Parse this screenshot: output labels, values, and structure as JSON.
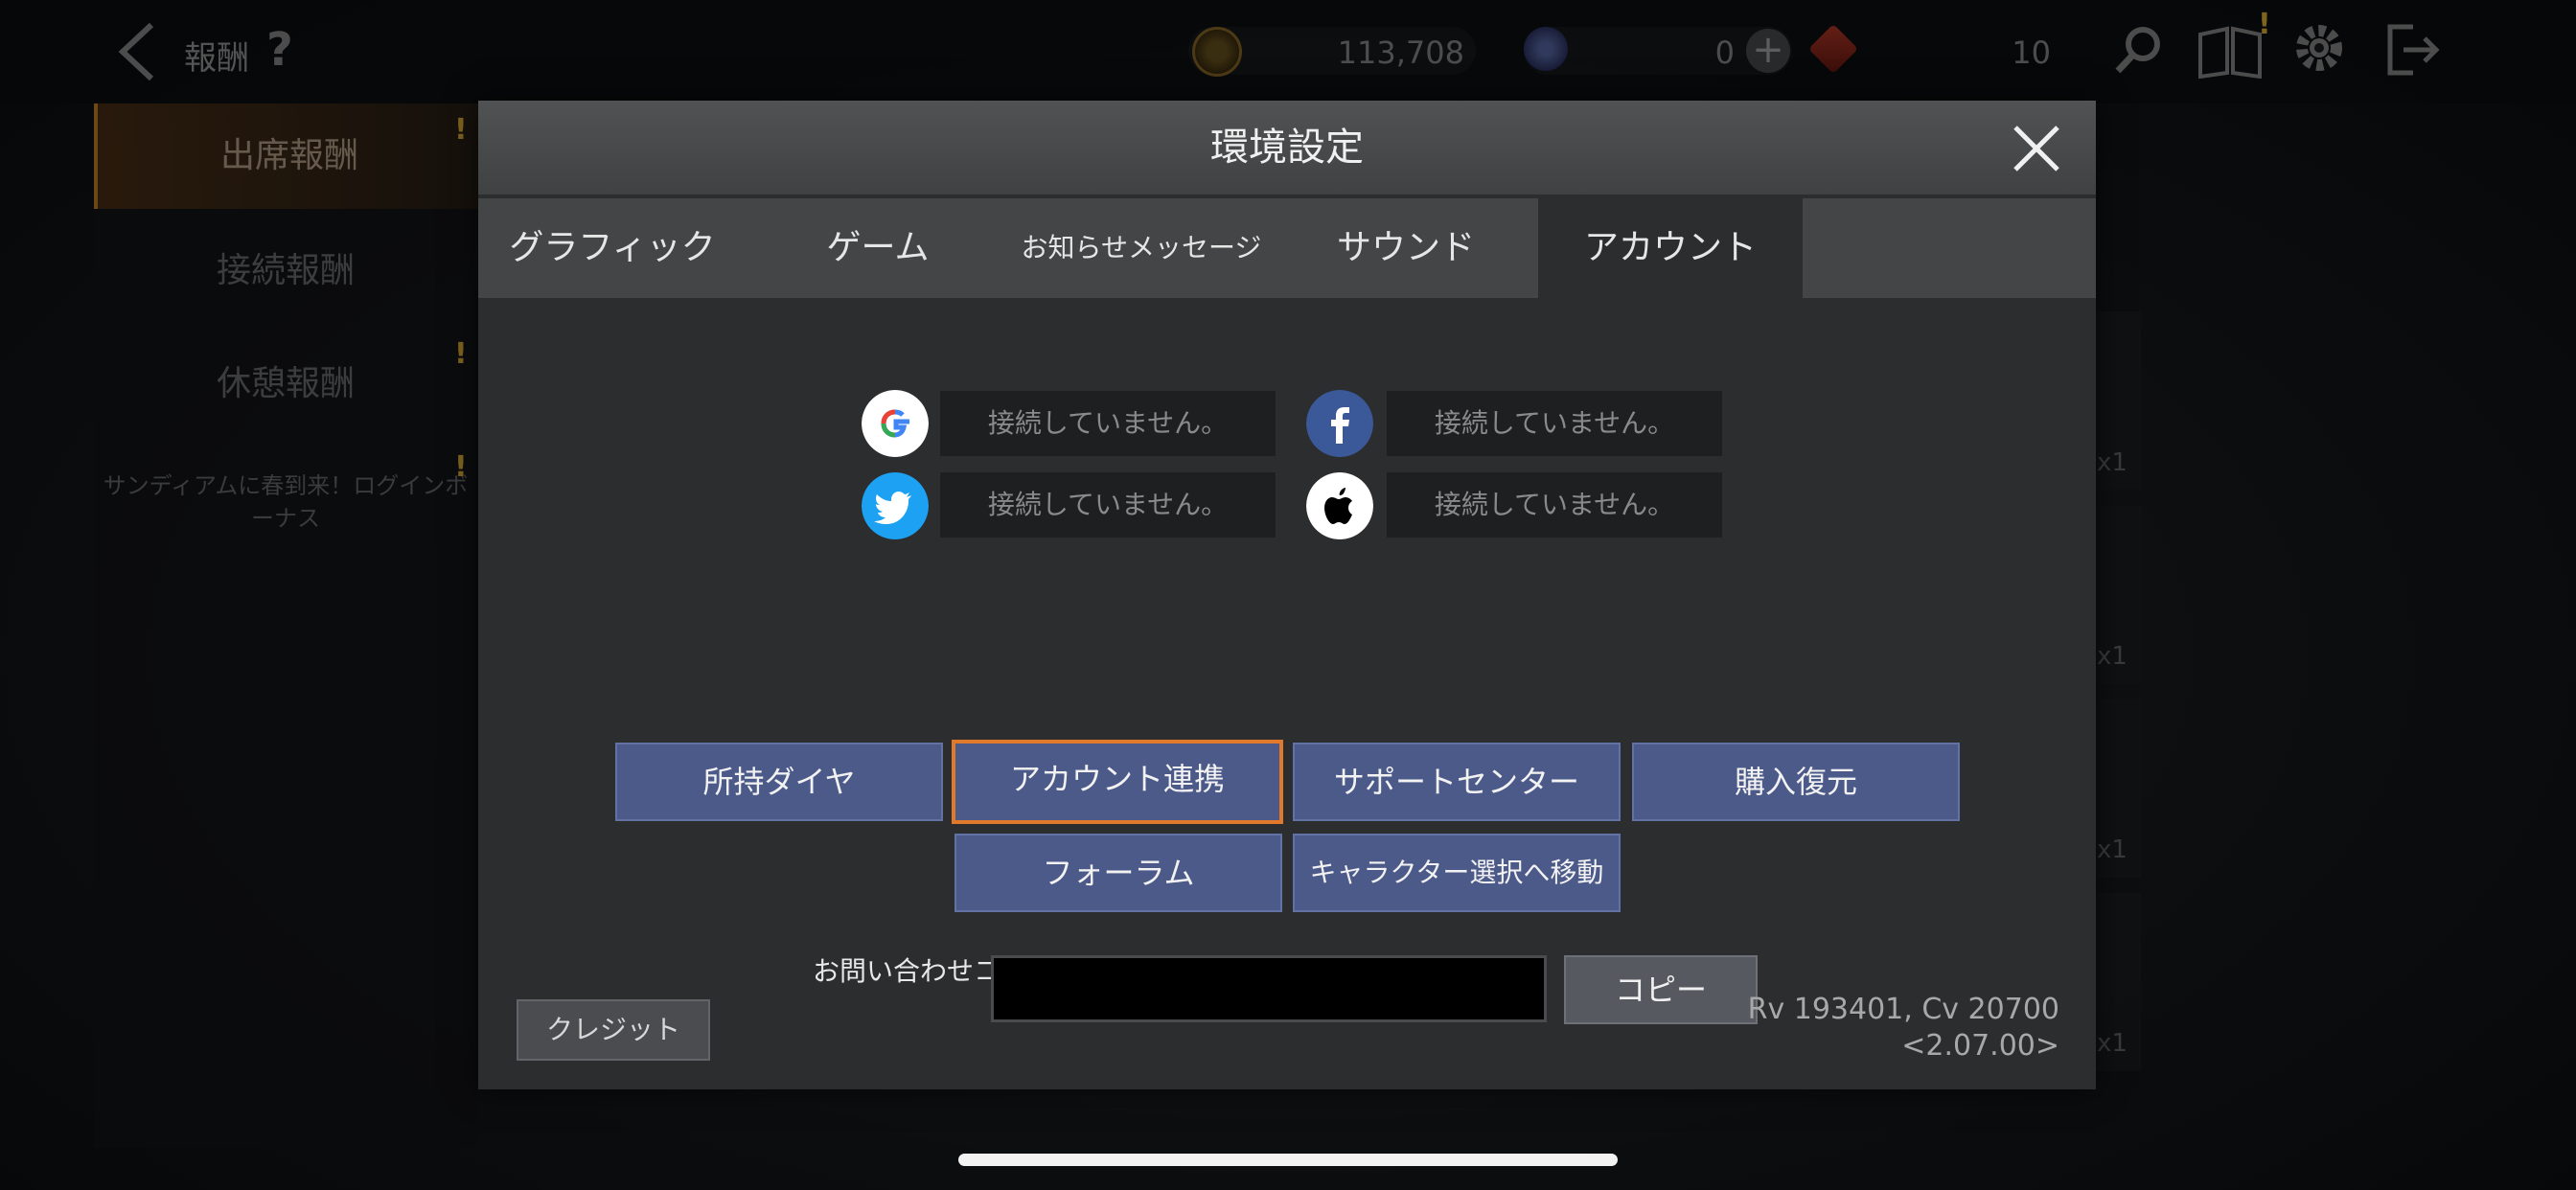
{
  "topbar": {
    "title": "報酬",
    "help": "?",
    "gold_value": "113,708",
    "gem_value": "0",
    "ruby_value": "10",
    "plus": "+"
  },
  "left_menu": {
    "items": [
      {
        "label": "出席報酬"
      },
      {
        "label": "接続報酬"
      },
      {
        "label": "休憩報酬"
      }
    ],
    "note": "サンディアムに春到来！ログインボーナス"
  },
  "right_cards": {
    "counts": [
      "x1",
      "x1",
      "x1",
      "x1"
    ]
  },
  "modal": {
    "title": "環境設定",
    "tabs": [
      {
        "label": "グラフィック"
      },
      {
        "label": "ゲーム"
      },
      {
        "label": "お知らせメッセージ"
      },
      {
        "label": "サウンド"
      },
      {
        "label": "アカウント"
      }
    ],
    "active_tab": "アカウント",
    "accounts": {
      "google": {
        "status": "接続していません。"
      },
      "facebook": {
        "status": "接続していません。"
      },
      "twitter": {
        "status": "接続していません。"
      },
      "apple": {
        "status": "接続していません。"
      }
    },
    "buttons": {
      "owned_diamonds": "所持ダイヤ",
      "account_link": "アカウント連携",
      "support_center": "サポートセンター",
      "restore_purchase": "購入復元",
      "forum": "フォーラム",
      "go_character_select": "キャラクター選択へ移動"
    },
    "inquiry_label": "お問い合わせコード",
    "inquiry_code": "",
    "copy_label": "コピー",
    "credit_label": "クレジット",
    "version_line1": "Rv 193401, Cv 20700",
    "version_line2": "<2.07.00>"
  },
  "colors": {
    "accent_selected": "#e07a2a",
    "button_bg": "#4c5a8a",
    "exclamation": "#e8b73a"
  }
}
